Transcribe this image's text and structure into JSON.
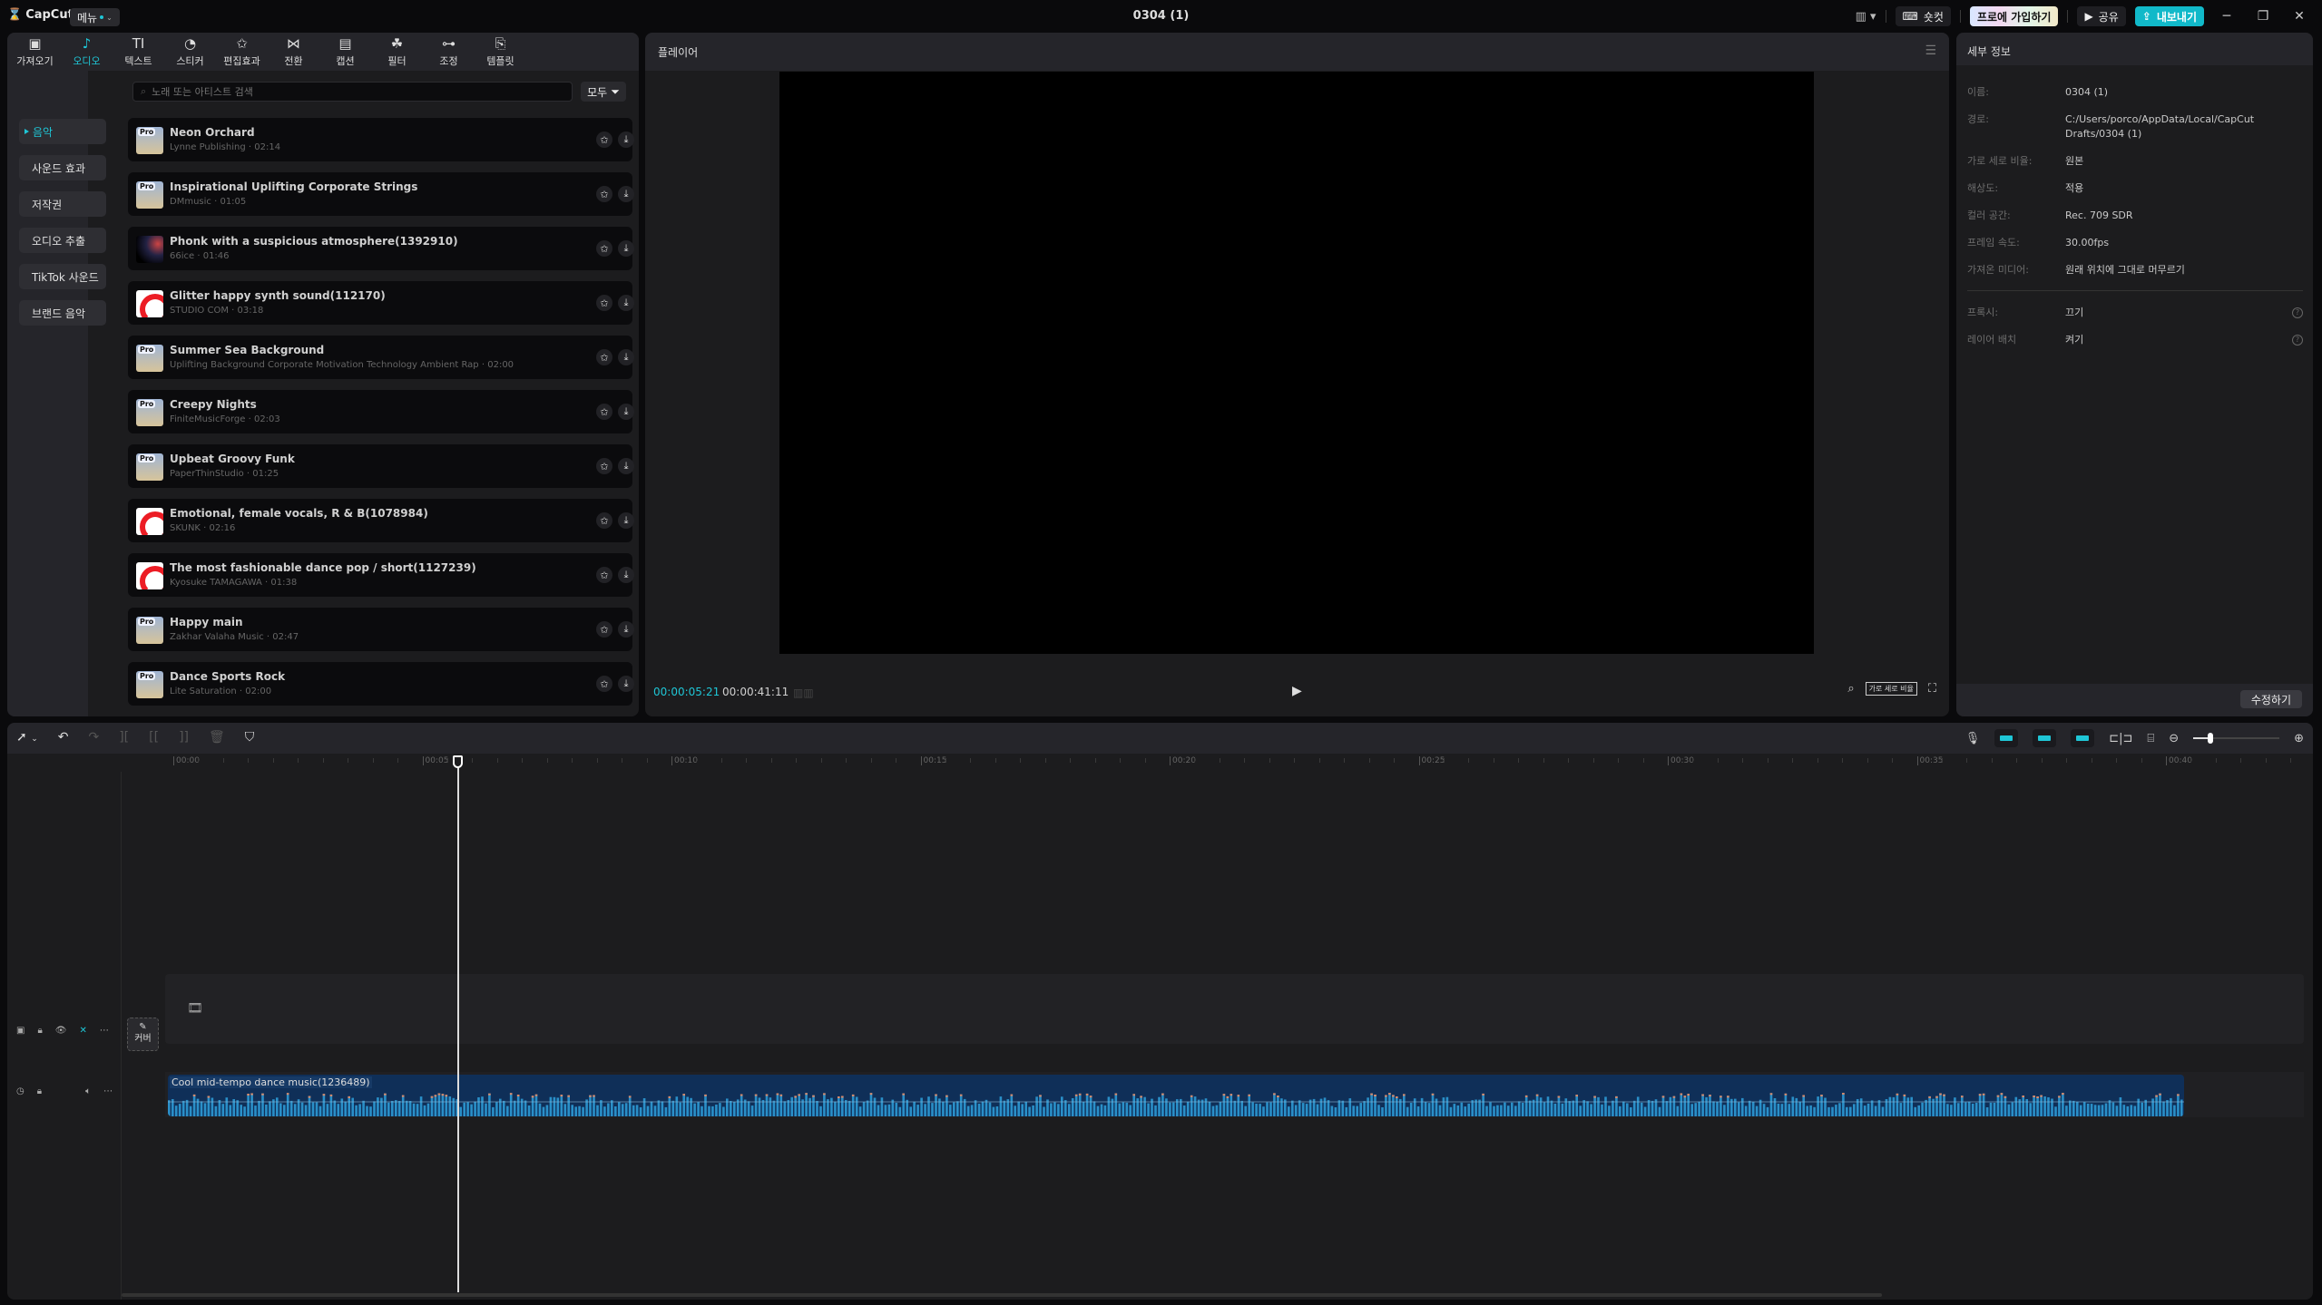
{
  "titlebar": {
    "app_name": "CapCut",
    "menu_label": "메뉴",
    "window_title": "0304 (1)",
    "shortcut_label": "숏컷",
    "pro_label": "프로에 가입하기",
    "share_label": "공유",
    "export_label": "내보내기"
  },
  "media_tabs": [
    {
      "label": "가져오기",
      "icon": "import-icon"
    },
    {
      "label": "오디오",
      "icon": "audio-icon",
      "active": true
    },
    {
      "label": "텍스트",
      "icon": "text-icon"
    },
    {
      "label": "스티커",
      "icon": "sticker-icon"
    },
    {
      "label": "편집효과",
      "icon": "effects-icon"
    },
    {
      "label": "전환",
      "icon": "transition-icon"
    },
    {
      "label": "캡션",
      "icon": "caption-icon"
    },
    {
      "label": "필터",
      "icon": "filter-icon"
    },
    {
      "label": "조정",
      "icon": "adjust-icon"
    },
    {
      "label": "템플릿",
      "icon": "template-icon"
    }
  ],
  "audio_nav": [
    {
      "label": "음악",
      "active": true
    },
    {
      "label": "사운드 효과"
    },
    {
      "label": "저작권"
    },
    {
      "label": "오디오 추출"
    },
    {
      "label": "TikTok 사운드"
    },
    {
      "label": "브랜드 음악"
    }
  ],
  "search": {
    "placeholder": "노래 또는 아티스트 검색",
    "value": ""
  },
  "filter_label": "모두",
  "tracks": [
    {
      "title": "Neon Orchard",
      "artist": "Lynne Publishing",
      "duration": "02:14",
      "pro": true
    },
    {
      "title": "Inspirational Uplifting Corporate Strings",
      "artist": "DMmusic",
      "duration": "01:05",
      "pro": true
    },
    {
      "title": "Phonk with a suspicious atmosphere(1392910)",
      "artist": "66ice",
      "duration": "01:46",
      "pro": false
    },
    {
      "title": "Glitter happy synth sound(112170)",
      "artist": "STUDIO COM",
      "duration": "03:18",
      "pro": false
    },
    {
      "title": "Summer Sea Background",
      "artist": "Uplifting Background Corporate Motivation Technology Ambient Rap",
      "duration": "02:00",
      "pro": true
    },
    {
      "title": "Creepy Nights",
      "artist": "FiniteMusicForge",
      "duration": "02:03",
      "pro": true
    },
    {
      "title": "Upbeat Groovy Funk",
      "artist": "PaperThinStudio",
      "duration": "01:25",
      "pro": true
    },
    {
      "title": "Emotional, female vocals, R & B(1078984)",
      "artist": "SKUNK",
      "duration": "02:16",
      "pro": false
    },
    {
      "title": "The most fashionable dance pop / short(1127239)",
      "artist": "Kyosuke TAMAGAWA",
      "duration": "01:38",
      "pro": false
    },
    {
      "title": "Happy main",
      "artist": "Zakhar Valaha Music",
      "duration": "02:47",
      "pro": true
    },
    {
      "title": "Dance Sports Rock",
      "artist": "Lite Saturation",
      "duration": "02:00",
      "pro": true
    }
  ],
  "player": {
    "title": "플레이어",
    "current_time": "00:00:05:21",
    "total_time": "00:00:41:11",
    "ratio_label": "가로 세로 비율"
  },
  "details": {
    "title": "세부 정보",
    "rows": [
      {
        "label": "이름:",
        "value": "0304 (1)"
      },
      {
        "label": "경로:",
        "value": "C:/Users/porco/AppData/Local/CapCut Drafts/0304 (1)"
      },
      {
        "label": "가로 세로 비율:",
        "value": "원본"
      },
      {
        "label": "해상도:",
        "value": "적용"
      },
      {
        "label": "컬러 공간:",
        "value": "Rec. 709 SDR"
      },
      {
        "label": "프레임 속도:",
        "value": "30.00fps"
      },
      {
        "label": "가져온 미디어:",
        "value": "원래 위치에 그대로 머무르기"
      }
    ],
    "extra_rows": [
      {
        "label": "프록시:",
        "value": "끄기"
      },
      {
        "label": "레이어 배치",
        "value": "켜기"
      }
    ],
    "edit_label": "수정하기"
  },
  "timeline": {
    "ticks": [
      "00:00",
      "00:05",
      "00:10",
      "00:15",
      "00:20",
      "00:25",
      "00:30",
      "00:35",
      "00:40"
    ],
    "playhead_seconds": 5.7,
    "zoom_level": 0.2,
    "cover_label": "커버",
    "audio_clip_name": "Cool mid-tempo dance music(1236489)"
  }
}
